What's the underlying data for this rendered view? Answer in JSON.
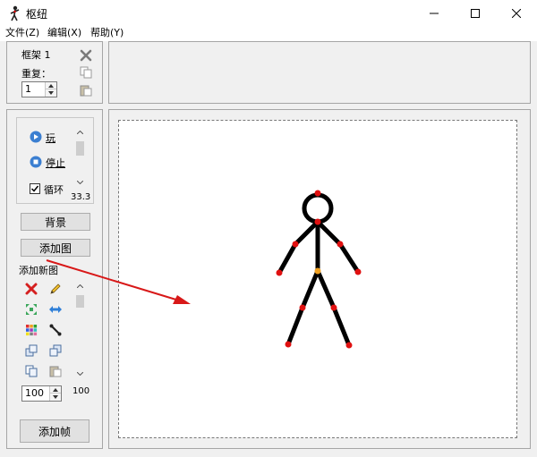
{
  "window": {
    "title": "枢纽",
    "app_icon": "stickman-icon",
    "controls": [
      "minimize-icon",
      "maximize-icon",
      "close-icon"
    ]
  },
  "menu": {
    "items": [
      {
        "label": "文件(Z)"
      },
      {
        "label": "编辑(X)"
      },
      {
        "label": "帮助(Y)"
      }
    ]
  },
  "frame_panel": {
    "frame_label": "框架 1",
    "repeat_label": "重复：",
    "repeat_value": "1",
    "icons": [
      "delete-x-icon",
      "copy-icon",
      "paste-icon"
    ]
  },
  "playback": {
    "play_label": "玩",
    "stop_label": "停止",
    "loop_label": "循环",
    "loop_checked": true,
    "speed_value": "33.3"
  },
  "figure_panel": {
    "background_button": "背景",
    "add_image_button": "添加图",
    "add_figure_label": "添加新图",
    "tools": [
      "delete-icon",
      "pencil-icon",
      "scale-icon",
      "flip-icon",
      "color-palette-icon",
      "joint-tool-icon",
      "bring-front-icon",
      "send-back-icon",
      "copy-figure-icon",
      "paste-figure-icon"
    ],
    "size_value": "100",
    "scroll_value": "100"
  },
  "bottom": {
    "add_frame_button": "添加帧"
  },
  "colors": {
    "accent": "#3b7fd1",
    "joint_red": "#e01010",
    "joint_orange": "#f0a020",
    "arrow_red": "#d81818"
  }
}
